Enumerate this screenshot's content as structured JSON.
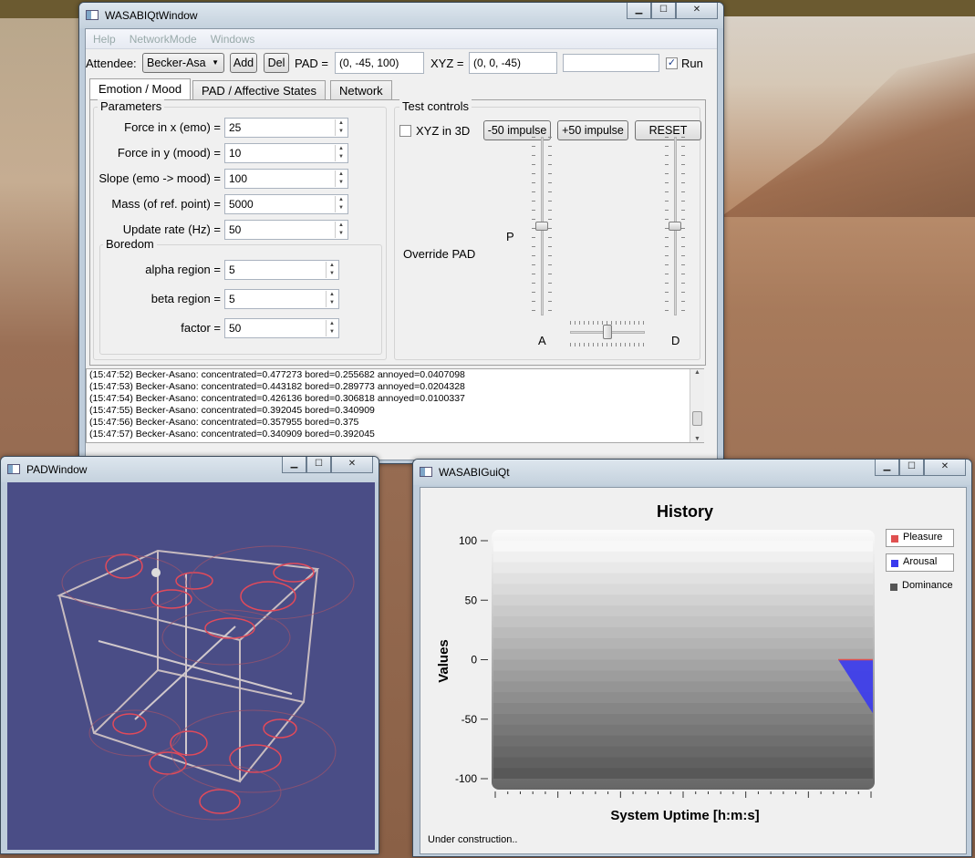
{
  "main": {
    "title": "WASABIQtWindow",
    "menu": [
      "Help",
      "NetworkMode",
      "Windows"
    ],
    "attendee_label": "Attendee:",
    "attendee_value": "Becker-Asa",
    "add_label": "Add",
    "del_label": "Del",
    "pad_label": "PAD =",
    "pad_value": "(0, -45, 100)",
    "xyz_label": "XYZ =",
    "xyz_value": "(0, 0, -45)",
    "free_field": "",
    "run_label": "Run",
    "run_checked": true,
    "tabs": [
      "Emotion / Mood",
      "PAD / Affective States",
      "Network"
    ],
    "params_title": "Parameters",
    "params": [
      {
        "label": "Force in x (emo) =",
        "value": "25"
      },
      {
        "label": "Force in y (mood) =",
        "value": "10"
      },
      {
        "label": "Slope (emo -> mood) =",
        "value": "100"
      },
      {
        "label": "Mass (of ref. point) =",
        "value": "5000"
      },
      {
        "label": "Update rate (Hz) =",
        "value": "50"
      }
    ],
    "boredom_title": "Boredom",
    "boredom": [
      {
        "label": "alpha region =",
        "value": "5"
      },
      {
        "label": "beta region =",
        "value": "5"
      },
      {
        "label": "factor =",
        "value": "50"
      }
    ],
    "test_title": "Test controls",
    "xyz3d_label": "XYZ in 3D",
    "minus_impulse": "-50 impulse",
    "plus_impulse": "+50 impulse",
    "reset": "RESET",
    "override_label": "Override PAD",
    "p_label": "P",
    "a_label": "A",
    "d_label": "D",
    "log": [
      "(15:47:52) Becker-Asano:  concentrated=0.477273 bored=0.255682 annoyed=0.0407098",
      "(15:47:53) Becker-Asano:  concentrated=0.443182 bored=0.289773 annoyed=0.0204328",
      "(15:47:54) Becker-Asano:  concentrated=0.426136 bored=0.306818 annoyed=0.0100337",
      "(15:47:55) Becker-Asano:  concentrated=0.392045 bored=0.340909",
      "(15:47:56) Becker-Asano:  concentrated=0.357955 bored=0.375",
      "(15:47:57) Becker-Asano:  concentrated=0.340909 bored=0.392045"
    ]
  },
  "pad": {
    "title": "PADWindow"
  },
  "gui": {
    "title": "WASABIGuiQt",
    "status": "Under construction.."
  },
  "chart_data": {
    "type": "area",
    "title": "History",
    "xlabel": "System Uptime [h:m:s]",
    "ylabel": "Values",
    "ylim": [
      -100,
      100
    ],
    "yticks": [
      "100",
      "50",
      "0",
      "-50",
      "-100"
    ],
    "series": [
      {
        "name": "Pleasure",
        "color": "#e05050",
        "values": [
          0,
          0
        ]
      },
      {
        "name": "Arousal",
        "color": "#3a3aee",
        "values": [
          0,
          -45
        ]
      },
      {
        "name": "Dominance",
        "color": "#555555",
        "values": [
          100,
          100
        ]
      }
    ]
  },
  "colors": {
    "pad_bg": "#4a4d86",
    "accent": "#3a3aee"
  }
}
